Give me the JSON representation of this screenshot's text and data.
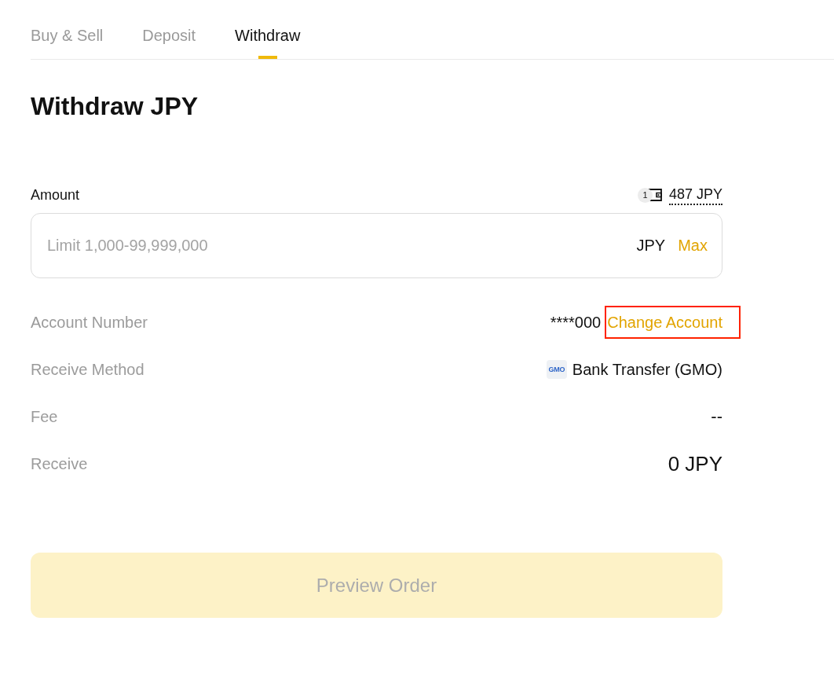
{
  "tabs": [
    {
      "label": "Buy & Sell",
      "selected": false
    },
    {
      "label": "Deposit",
      "selected": false
    },
    {
      "label": "Withdraw",
      "selected": true
    }
  ],
  "title": "Withdraw JPY",
  "amount": {
    "label": "Amount",
    "balance_badge": "1",
    "balance": "487 JPY",
    "placeholder": "Limit 1,000-99,999,000",
    "currency": "JPY",
    "max_label": "Max"
  },
  "details": [
    {
      "kind": "account",
      "label": "Account Number",
      "value": "****000",
      "action": {
        "label": "Change Account",
        "highlighted": true
      }
    },
    {
      "kind": "method",
      "label": "Receive Method",
      "logo": "GMO",
      "value": "Bank Transfer (GMO)"
    },
    {
      "kind": "plain",
      "label": "Fee",
      "value": "--"
    },
    {
      "kind": "total",
      "label": "Receive",
      "value": "0 JPY"
    }
  ],
  "submit": {
    "label": "Preview Order",
    "disabled": true
  }
}
